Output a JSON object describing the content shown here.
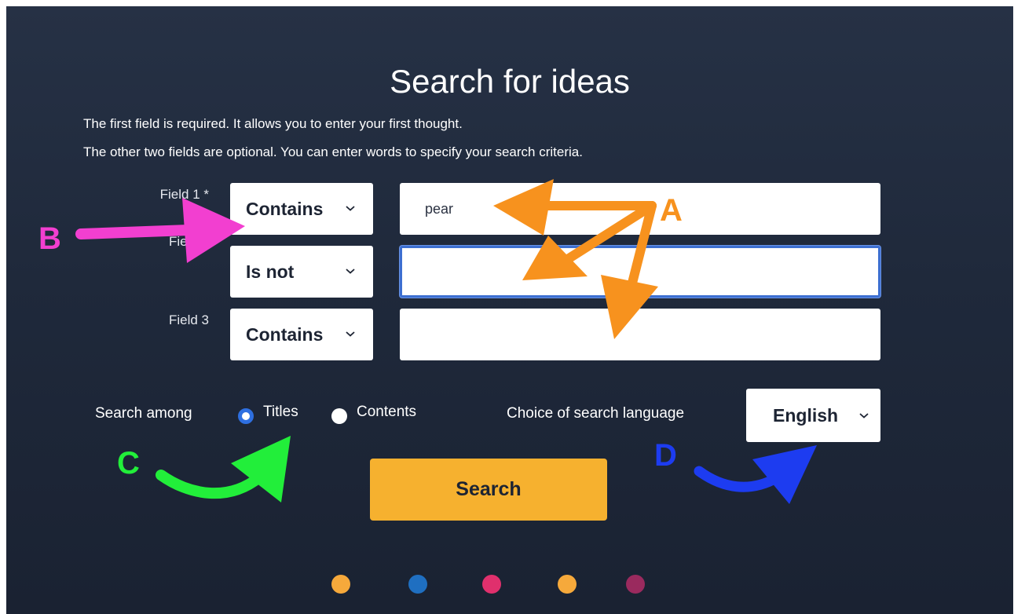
{
  "page": {
    "title": "Search for ideas",
    "description_line1": "The first field is required. It allows you to enter your first thought.",
    "description_line2": "The other two fields are optional. You can enter words to specify your search criteria."
  },
  "fields": [
    {
      "label": "Field 1 *",
      "operator": "Contains",
      "value": "pear"
    },
    {
      "label": "Field 2",
      "operator": "Is not",
      "value": ""
    },
    {
      "label": "Field 3",
      "operator": "Contains",
      "value": ""
    }
  ],
  "search_among": {
    "label": "Search among",
    "options": [
      {
        "label": "Titles",
        "selected": true
      },
      {
        "label": "Contents",
        "selected": false
      }
    ]
  },
  "language": {
    "label": "Choice of search language",
    "value": "English"
  },
  "search_button": {
    "label": "Search"
  },
  "pagination_dots": [
    "#f6a93b",
    "#1f6fc1",
    "#e0306d",
    "#f6a93b",
    "#9a2a5e"
  ],
  "annotations": {
    "a": {
      "letter": "A",
      "color": "#f7921e"
    },
    "b": {
      "letter": "B",
      "color": "#f23fd0"
    },
    "c": {
      "letter": "C",
      "color": "#22ee3a"
    },
    "d": {
      "letter": "D",
      "color": "#1d3cf0"
    }
  },
  "colors": {
    "background": "#222c3f",
    "accent_button": "#f6b12f",
    "focus_ring": "#3d6fd1",
    "radio_selected": "#2e6fe0"
  },
  "icons": {
    "dropdown": "chevron-down-icon"
  }
}
